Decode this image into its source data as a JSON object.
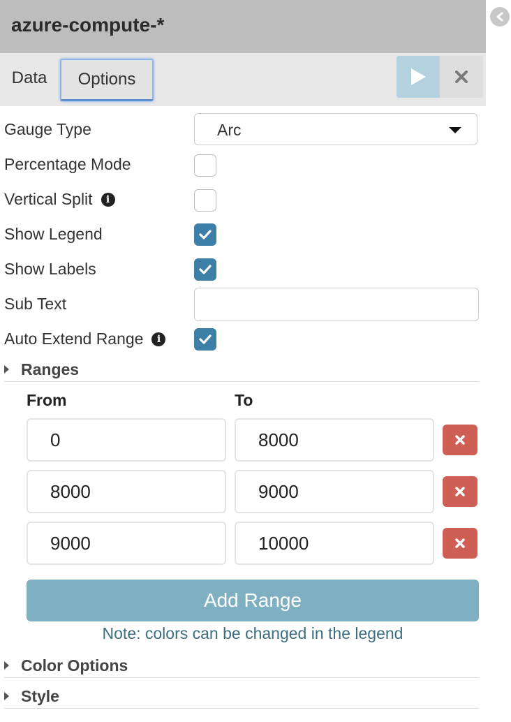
{
  "header": {
    "title": "azure-compute-*"
  },
  "tabs": [
    {
      "label": "Data"
    },
    {
      "label": "Options"
    }
  ],
  "toolbar": {
    "run_icon": "play-icon",
    "close_icon": "close-icon"
  },
  "options": {
    "gauge_type": {
      "label": "Gauge Type",
      "value": "Arc"
    },
    "percentage_mode": {
      "label": "Percentage Mode",
      "checked": false
    },
    "vertical_split": {
      "label": "Vertical Split",
      "checked": false
    },
    "show_legend": {
      "label": "Show Legend",
      "checked": true
    },
    "show_labels": {
      "label": "Show Labels",
      "checked": true
    },
    "sub_text": {
      "label": "Sub Text",
      "value": ""
    },
    "auto_extend_range": {
      "label": "Auto Extend Range",
      "checked": true
    }
  },
  "ranges": {
    "section_label": "Ranges",
    "from_header": "From",
    "to_header": "To",
    "rows": [
      {
        "from": "0",
        "to": "8000"
      },
      {
        "from": "8000",
        "to": "9000"
      },
      {
        "from": "9000",
        "to": "10000"
      }
    ],
    "add_button": "Add Range",
    "note": "Note: colors can be changed in the legend"
  },
  "sections": {
    "color_options": "Color Options",
    "style": "Style"
  },
  "colors": {
    "accent": "#3d7fa6",
    "danger": "#cf5e55",
    "add_button": "#7fb0c2",
    "header": "#bdbdbd"
  }
}
